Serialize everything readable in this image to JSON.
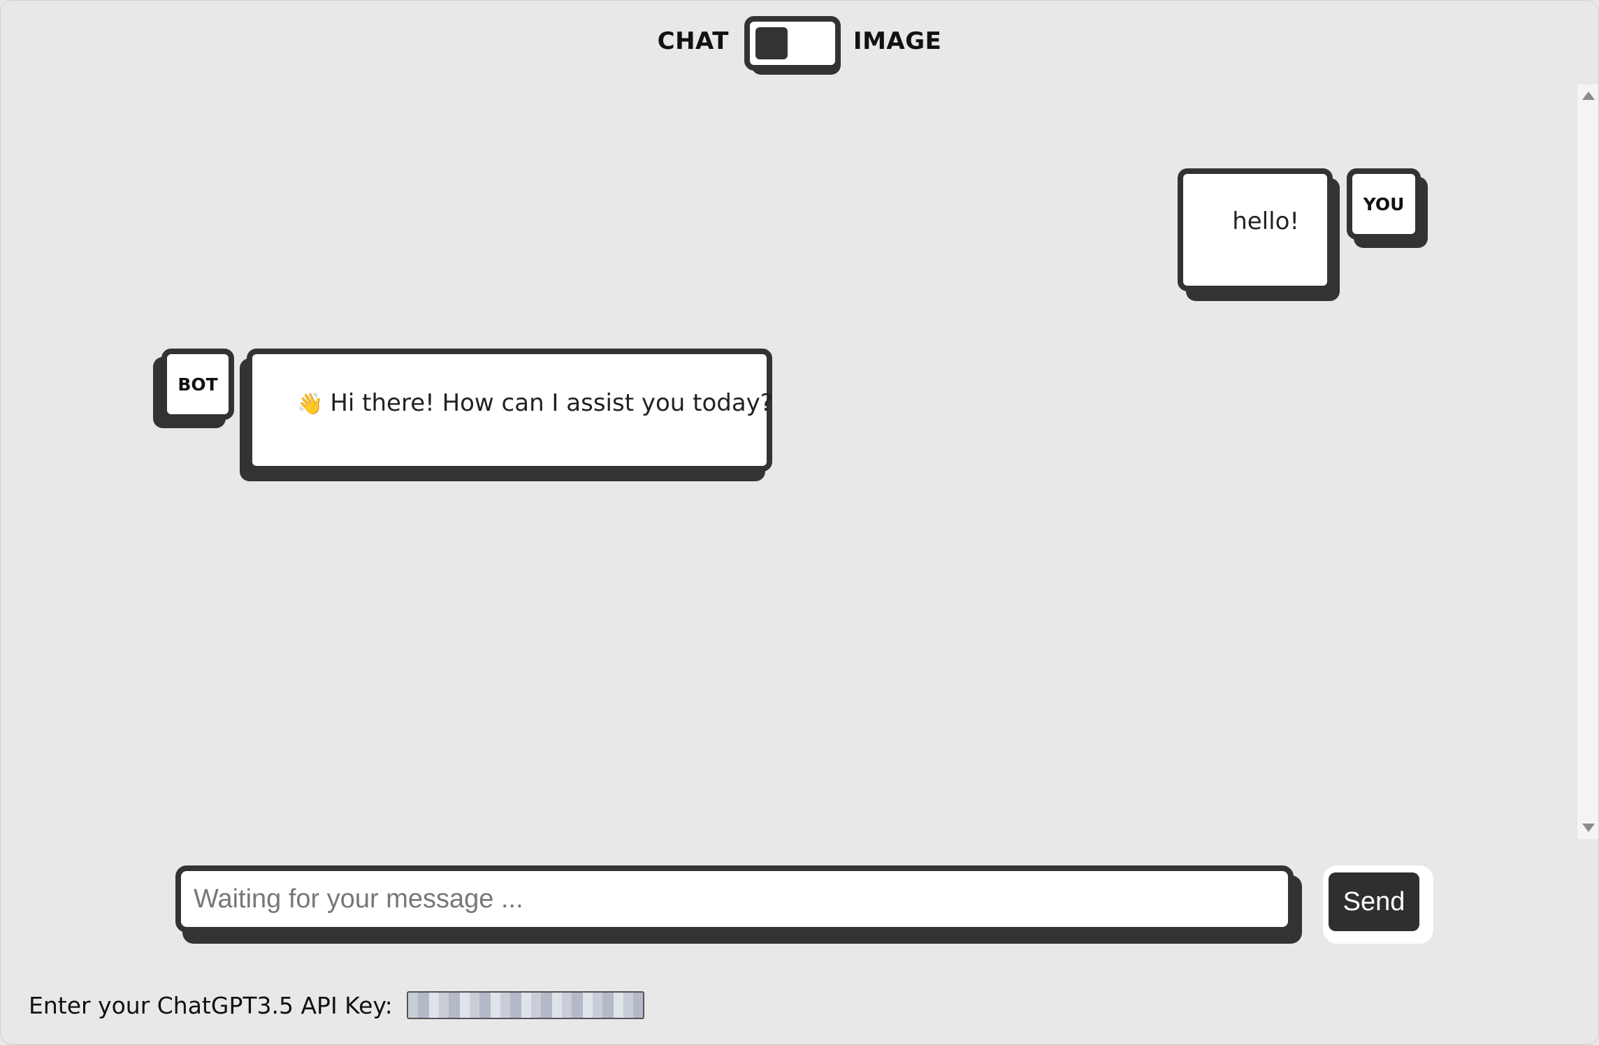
{
  "mode_toggle": {
    "left_label": "CHAT",
    "right_label": "IMAGE",
    "selected": "CHAT"
  },
  "messages": [
    {
      "sender": "YOU",
      "text": "hello!"
    },
    {
      "sender": "BOT",
      "icon": "👋",
      "text": "Hi there! How can I assist you today?"
    }
  ],
  "composer": {
    "placeholder": "Waiting for your message ...",
    "value": "",
    "send_label": "Send"
  },
  "api_key": {
    "label": "Enter your ChatGPT3.5 API Key:"
  }
}
